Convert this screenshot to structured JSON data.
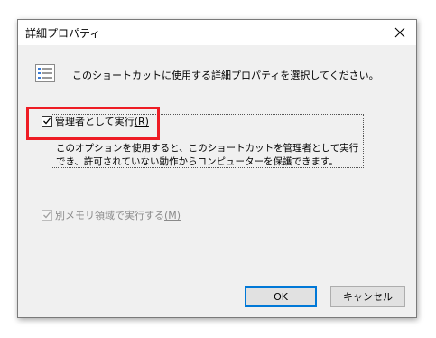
{
  "window": {
    "title": "詳細プロパティ"
  },
  "description": "このショートカットに使用する詳細プロパティを選択してください。",
  "options": {
    "run_as_admin": {
      "label": "管理者として実行",
      "accelerator": "(R)",
      "checked": true,
      "description": "このオプションを使用すると、このショートカットを管理者として実行でき、許可されていない動作からコンピューターを保護できます。"
    },
    "separate_memory": {
      "label": "別メモリ領域で実行する",
      "accelerator": "(M)",
      "checked": true,
      "enabled": false
    }
  },
  "buttons": {
    "ok": "OK",
    "cancel": "キャンセル"
  },
  "icons": {
    "close": "close-icon",
    "properties": "properties-list-icon"
  },
  "colors": {
    "highlight": "#ee1c24",
    "ok_border": "#0078d7",
    "checkmark_disabled": "#a0a0a0"
  }
}
